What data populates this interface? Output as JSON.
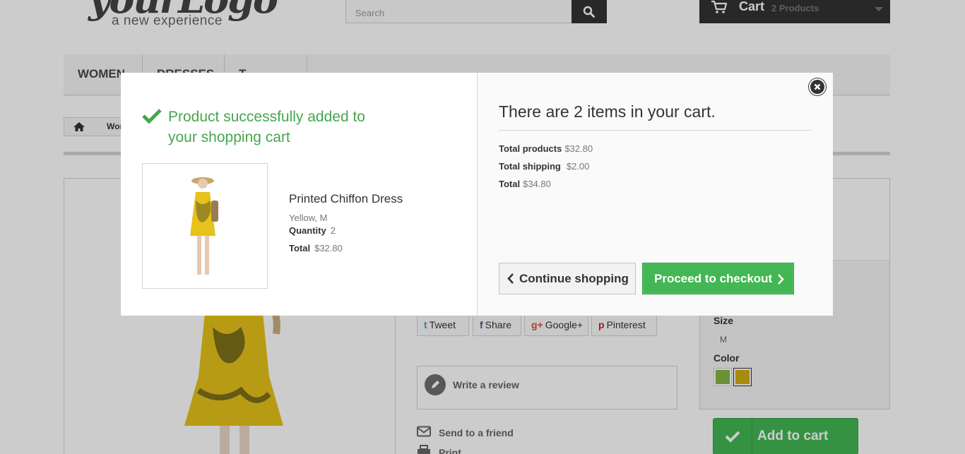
{
  "header": {
    "logo_script": "yourLogo",
    "logo_tagline": "a new experience",
    "search_placeholder": "Search",
    "cart_label": "Cart",
    "cart_count": "2 Products"
  },
  "menu": {
    "items": [
      "Women",
      "Dresses",
      "T-shirts"
    ]
  },
  "breadcrumb": {
    "text": "Wom"
  },
  "social": {
    "tweet": "Tweet",
    "share": "Share",
    "googleplus": "Google+",
    "pinterest": "Pinterest"
  },
  "product_page": {
    "write_review": "Write a review",
    "send_to_friend": "Send to a friend",
    "print": "Print",
    "size_label": "Size",
    "size_value": "M",
    "color_label": "Color",
    "colors": [
      "#85b446",
      "#d4ae13"
    ],
    "add_to_cart": "Add to cart"
  },
  "modal": {
    "success_title": "Product successfully added to your shopping cart",
    "product_name": "Printed Chiffon Dress",
    "product_attributes": "Yellow, M",
    "quantity_label": "Quantity",
    "quantity_value": "2",
    "total_label": "Total",
    "total_value": "$32.80",
    "cart_heading": "There are 2 items in your cart.",
    "total_products_label": "Total products",
    "total_products_value": "$32.80",
    "total_shipping_label": "Total shipping",
    "total_shipping_value": "$2.00",
    "grand_total_label": "Total",
    "grand_total_value": "$34.80",
    "continue_label": "Continue shopping",
    "checkout_label": "Proceed to checkout"
  },
  "colors": {
    "success_green": "#46a74e",
    "checkout_green": "#43b754",
    "dark": "#333333"
  }
}
